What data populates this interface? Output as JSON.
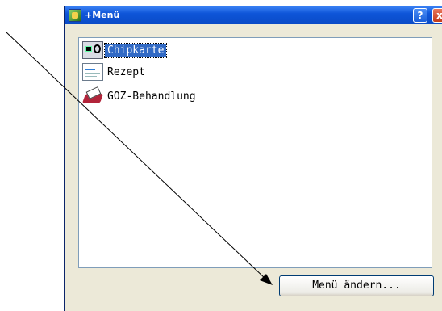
{
  "window": {
    "title": "+Menü",
    "help_label": "?",
    "close_label": "x"
  },
  "menu_list": {
    "items": [
      {
        "label": "Chipkarte",
        "icon": "chip-card-icon",
        "selected": true
      },
      {
        "label": "Rezept",
        "icon": "prescription-icon",
        "selected": false
      },
      {
        "label": "GOZ-Behandlung",
        "icon": "treatment-icon",
        "selected": false
      }
    ]
  },
  "buttons": {
    "change_menu_label": "Menü ändern..."
  },
  "colors": {
    "titlebar": "#0e55d8",
    "selection": "#316ac5",
    "dialog_bg": "#ece9d8"
  }
}
